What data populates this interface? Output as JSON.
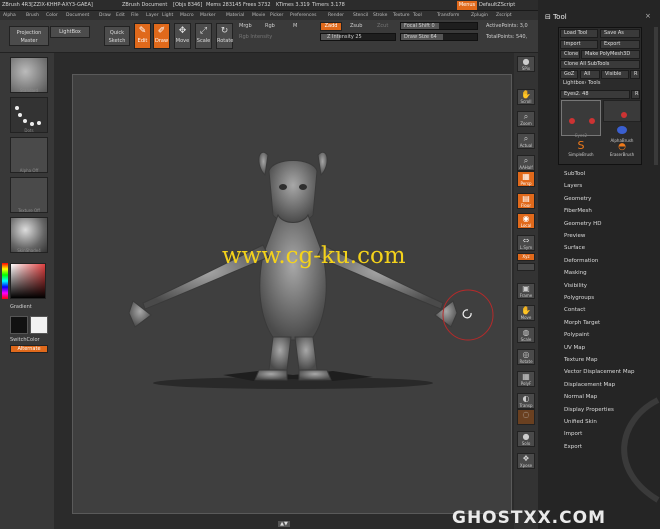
{
  "menubar": {
    "items": [
      "Alpha",
      "Brush",
      "Color",
      "Document",
      "Draw",
      "Edit",
      "File",
      "Layer",
      "Light",
      "Macro",
      "Marker",
      "Material",
      "Movie",
      "Picker",
      "Preferences",
      "Render",
      "Stencil",
      "Stroke",
      "Texture",
      "Tool",
      "Transform",
      "Zplugin",
      "Zscript"
    ],
    "app_title": "ZBrush 4R3[ZZIX-KHHP-AXY3-GAEA]",
    "doc_title": "ZBrush Document",
    "objs": "[Objs 8346]",
    "mem": "Mems 283145",
    "frees": "Frees 3732",
    "ktimes": "KTimes 3.319",
    "timers": "Timers 3.178",
    "menus_button": "Menus",
    "default_script": "DefaultZScript"
  },
  "topshelf": {
    "projection_master": "Projection Master",
    "lightbox": "LightBox",
    "quick_sketch": "Quick Sketch",
    "edit": "Edit",
    "draw": "Draw",
    "move": "Move",
    "scale": "Scale",
    "rotate": "Rotate",
    "mrgb": "Mrgb",
    "rgb": "Rgb",
    "m": "M",
    "rgb_intensity": "Rgb Intensity",
    "zadd": "Zadd",
    "zsub": "Zsub",
    "zcut": "Zcut",
    "z_intensity": "Z Intensity 25",
    "focal_shift": "Focal Shift 0",
    "draw_size": "Draw Size 64",
    "active_points": "ActivePoints: 3,0",
    "total_points": "TotalPoints: 540,"
  },
  "leftshelf": {
    "labels": [
      "Standard",
      "Dots",
      "Alpha Off",
      "Texture Off",
      "SkinShade4"
    ],
    "gradient": "Gradient",
    "switch_color": "SwitchColor",
    "alternate": "Alternate"
  },
  "rightshelf": {
    "buttons": [
      "SPix",
      "Scroll",
      "Zoom",
      "Actual",
      "AAHalf",
      "Persp",
      "Floor",
      "Local",
      "L.Sym",
      "Xyz",
      "",
      "Frame",
      "Move",
      "Scale",
      "Rotate",
      "",
      "PolyF",
      "Transp",
      "Ghost",
      "Solo",
      "Xpose"
    ]
  },
  "tool_panel": {
    "title": "Tool",
    "load_tool": "Load Tool",
    "save_as": "Save As",
    "import": "Import",
    "export": "Export",
    "clone": "Clone",
    "make_polymesh3d": "Make PolyMesh3D",
    "clone_all_subtools": "Clone All SubTools",
    "goz": "GoZ",
    "all": "All",
    "visible": "Visible",
    "r": "R",
    "lightbox_tools": "Lightbox› Tools",
    "eyes2": "Eyes2. 48",
    "r2": "R",
    "thumb_labels": [
      "Eyes2",
      "SimpleBrush",
      "EraserBrush",
      "AlphaBrush"
    ],
    "sections": [
      "SubTool",
      "Layers",
      "Geometry",
      "FiberMesh",
      "Geometry HD",
      "Preview",
      "Surface",
      "Deformation",
      "Masking",
      "Visibility",
      "Polygroups",
      "Contact",
      "Morph Target",
      "Polypaint",
      "UV Map",
      "Texture Map",
      "Vector Displacement Map",
      "Displacement Map",
      "Normal Map",
      "Display Properties",
      "Unified Skin",
      "Import",
      "Export"
    ]
  },
  "watermark": "www.cg-ku.com",
  "footer_logo": "GHOSTXX.COM",
  "colors": {
    "accent": "#e0691b",
    "canvas": "#3f3f3f",
    "watermark": "#f4d21b"
  }
}
